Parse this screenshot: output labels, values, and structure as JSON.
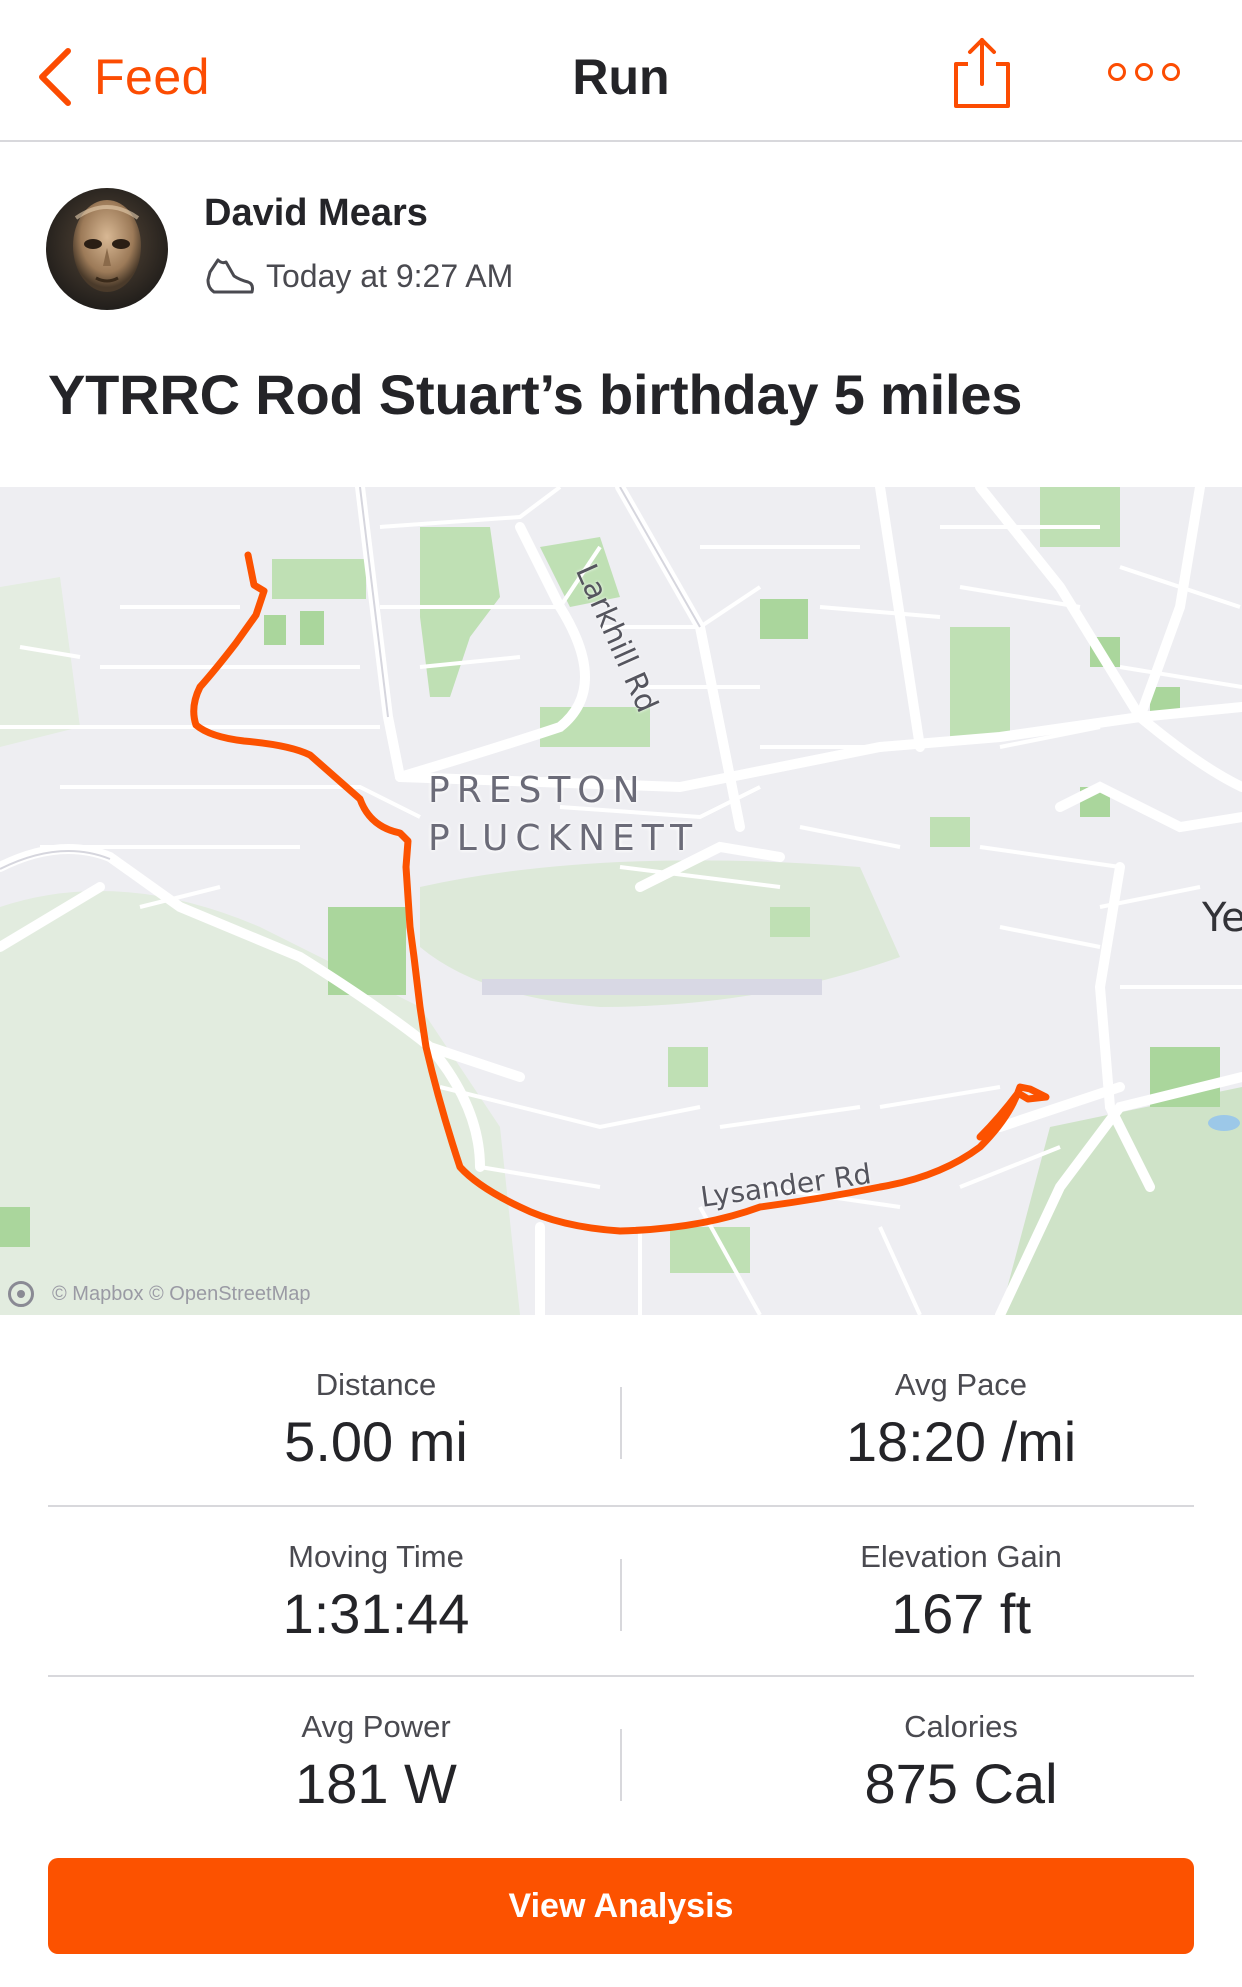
{
  "nav": {
    "back_label": "Feed",
    "title": "Run",
    "share_icon": "share-icon",
    "more_icon": "more-options-icon"
  },
  "header": {
    "athlete_name": "David Mears",
    "timestamp": "Today at 9:27 AM",
    "activity_icon": "run-shoe-icon",
    "activity_title": "YTRRC Rod Stuart’s birthday 5 miles"
  },
  "map": {
    "place_label_line1": "PRESTON",
    "place_label_line2": "PLUCKNETT",
    "road_label_top": "Larkhill Rd",
    "road_label_bottom": "Lysander Rd",
    "town_label": "Ye",
    "attribution": "© Mapbox © OpenStreetMap",
    "route_color": "#fc5200"
  },
  "stats": {
    "distance_label": "Distance",
    "distance_value": "5.00 mi",
    "pace_label": "Avg Pace",
    "pace_value": "18:20 /mi",
    "moving_time_label": "Moving Time",
    "moving_time_value": "1:31:44",
    "elevation_label": "Elevation Gain",
    "elevation_value": "167 ft",
    "power_label": "Avg Power",
    "power_value": "181 W",
    "calories_label": "Calories",
    "calories_value": "875 Cal"
  },
  "actions": {
    "view_analysis_label": "View Analysis"
  },
  "colors": {
    "accent": "#fc4c02",
    "button": "#fc5200"
  }
}
